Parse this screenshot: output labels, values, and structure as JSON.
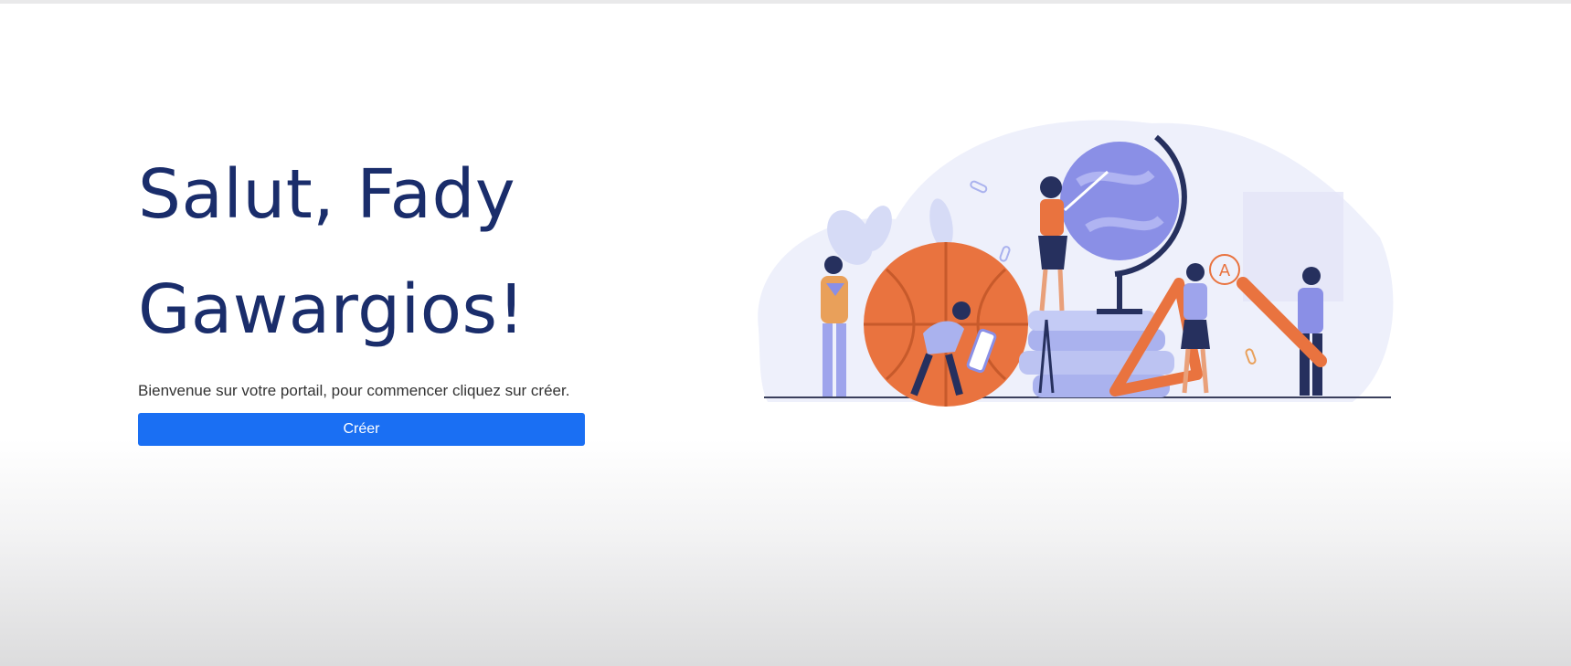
{
  "hero": {
    "greeting_line1": "Salut, Fady",
    "greeting_line2": "Gawargios!",
    "subtitle": "Bienvenue sur votre portail, pour commencer cliquez sur créer.",
    "create_label": "Créer"
  },
  "illustration": {
    "grade_mark": "A",
    "icon": "education-illustration"
  },
  "colors": {
    "title": "#1a2d6b",
    "button": "#1a6ff3",
    "accent_orange": "#e9733f",
    "accent_purple": "#8a8fe6"
  }
}
